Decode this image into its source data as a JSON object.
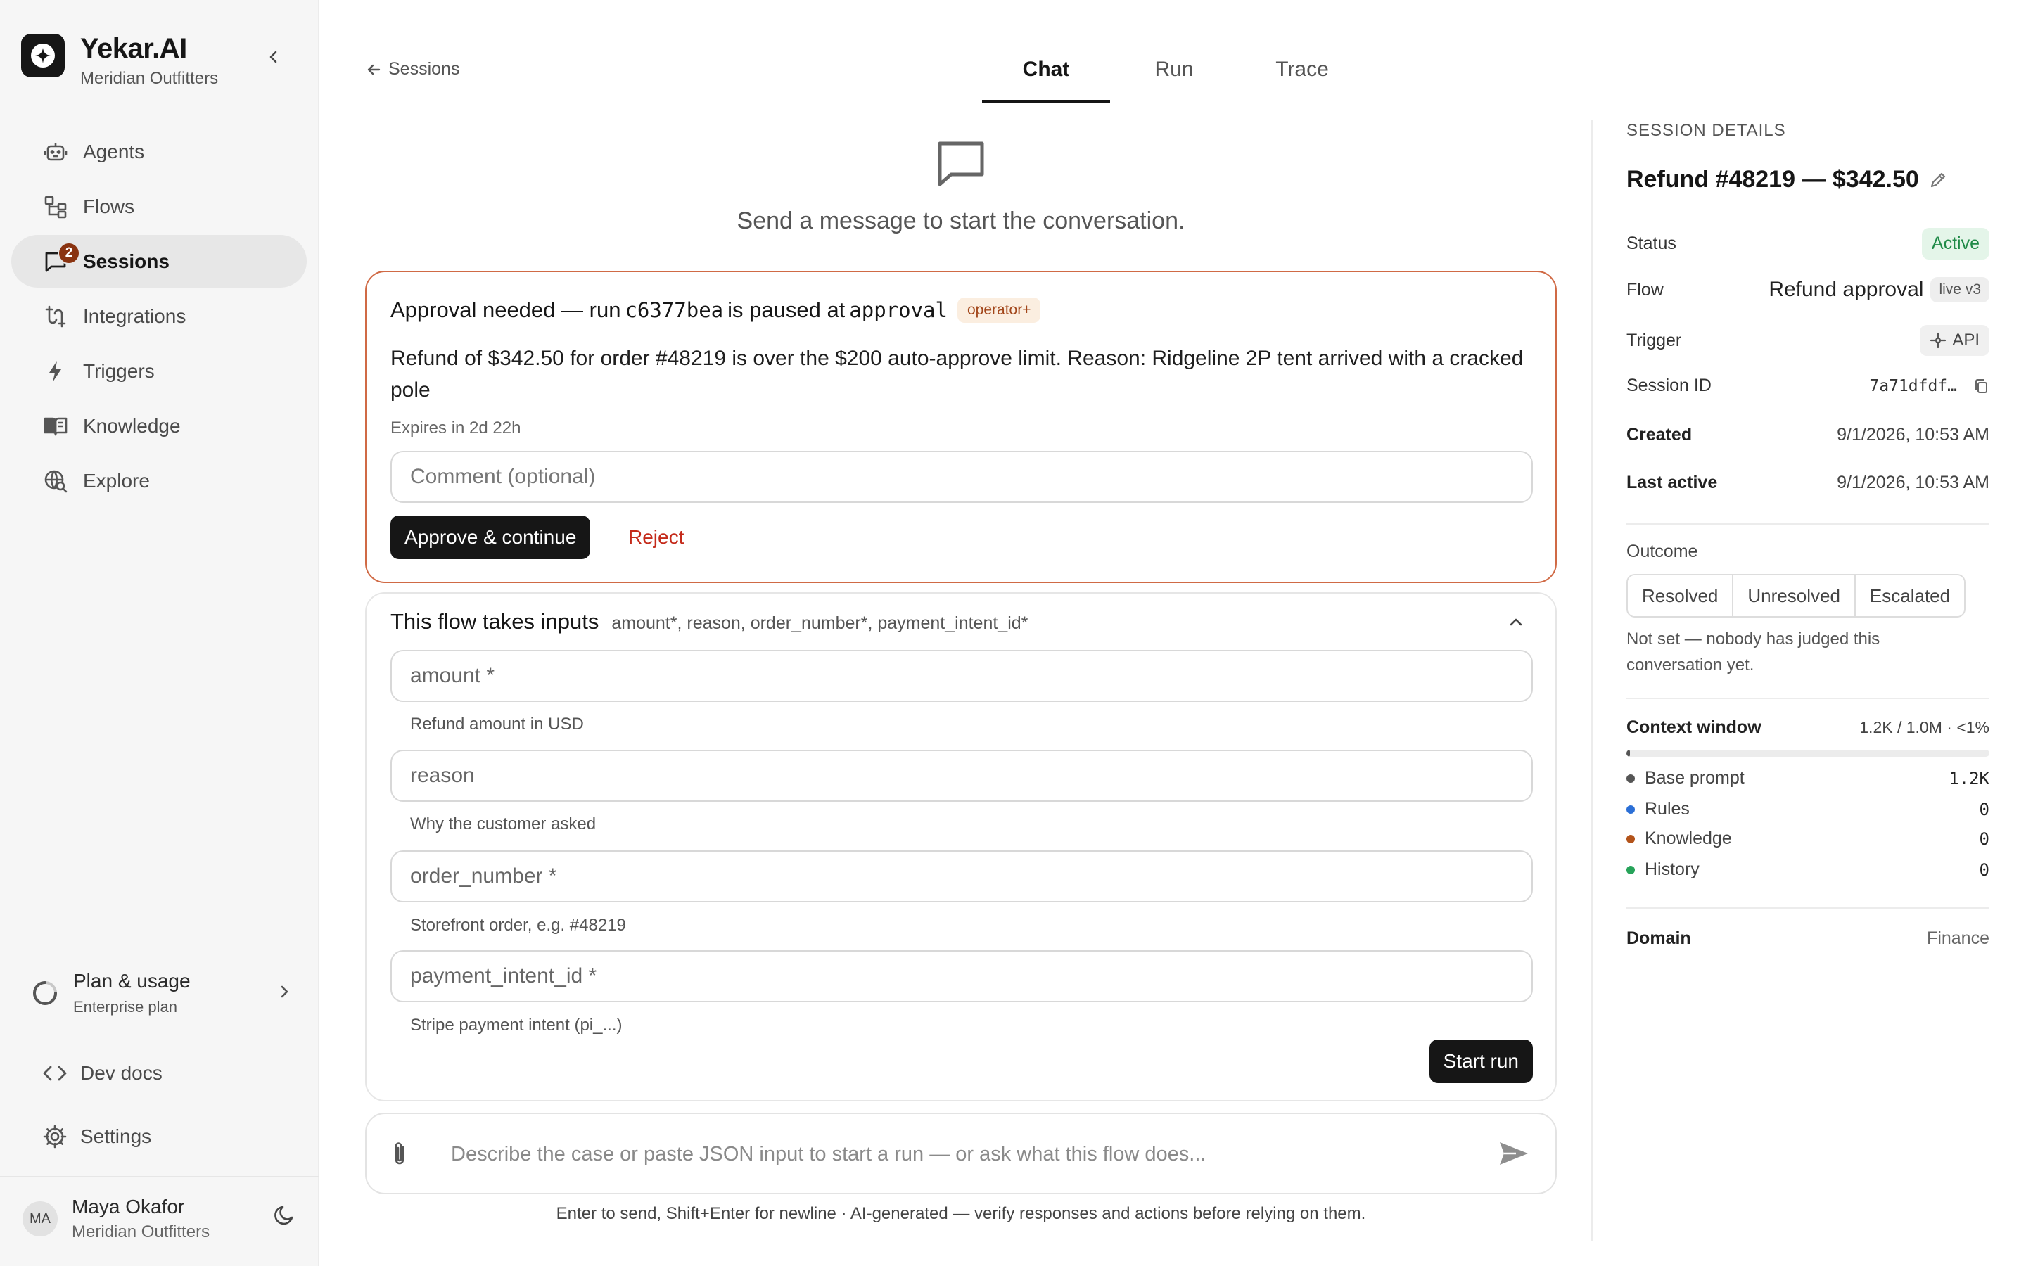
{
  "brand": {
    "name": "Yekar.AI",
    "org": "Meridian Outfitters"
  },
  "nav": {
    "items": [
      {
        "label": "Agents",
        "icon": "robot-icon"
      },
      {
        "label": "Flows",
        "icon": "flow-icon"
      },
      {
        "label": "Sessions",
        "icon": "chat-icon",
        "badge": "2",
        "active": true
      },
      {
        "label": "Integrations",
        "icon": "plug-icon"
      },
      {
        "label": "Triggers",
        "icon": "bolt-icon"
      },
      {
        "label": "Knowledge",
        "icon": "book-icon"
      },
      {
        "label": "Explore",
        "icon": "globe-search-icon"
      }
    ]
  },
  "plan": {
    "title": "Plan & usage",
    "sub": "Enterprise plan"
  },
  "devdocs": {
    "label": "Dev docs"
  },
  "settings": {
    "label": "Settings"
  },
  "user": {
    "initials": "MA",
    "name": "Maya Okafor",
    "org": "Meridian Outfitters"
  },
  "header": {
    "back_label": "Sessions",
    "tabs": [
      {
        "label": "Chat",
        "active": true
      },
      {
        "label": "Run"
      },
      {
        "label": "Trace"
      }
    ]
  },
  "empty_state": {
    "text": "Send a message to start the conversation."
  },
  "approval": {
    "title_prefix": "Approval needed — run",
    "run_id": "c6377bea",
    "title_mid": "is paused at",
    "step": "approval",
    "role_tag": "operator+",
    "reason": "Refund of $342.50 for order #48219 is over the $200 auto-approve limit. Reason: Ridgeline 2P tent arrived with a cracked pole",
    "expires": "Expires in 2d 22h",
    "comment_placeholder": "Comment (optional)",
    "approve_label": "Approve & continue",
    "reject_label": "Reject"
  },
  "inputs": {
    "title": "This flow takes inputs",
    "summary": "amount*, reason, order_number*, payment_intent_id*",
    "fields": [
      {
        "placeholder": "amount *",
        "hint": "Refund amount in USD"
      },
      {
        "placeholder": "reason",
        "hint": "Why the customer asked"
      },
      {
        "placeholder": "order_number *",
        "hint": "Storefront order, e.g. #48219"
      },
      {
        "placeholder": "payment_intent_id *",
        "hint": "Stripe payment intent (pi_...)"
      }
    ],
    "start_label": "Start run"
  },
  "composer": {
    "placeholder": "Describe the case or paste JSON input to start a run — or ask what this flow does...",
    "footer": "Enter to send, Shift+Enter for newline · AI-generated — verify responses and actions before relying on them."
  },
  "session": {
    "heading": "SESSION DETAILS",
    "title": "Refund #48219 — $342.50",
    "status_label": "Status",
    "status": "Active",
    "flow_label": "Flow",
    "flow": "Refund approval",
    "flow_version": "live v3",
    "trigger_label": "Trigger",
    "trigger": "API",
    "session_id_label": "Session ID",
    "session_id": "7a71dfdf…",
    "created_label": "Created",
    "created": "9/1/2026, 10:53 AM",
    "last_active_label": "Last active",
    "last_active": "9/1/2026, 10:53 AM",
    "outcome_label": "Outcome",
    "outcome_options": [
      "Resolved",
      "Unresolved",
      "Escalated"
    ],
    "outcome_note": "Not set — nobody has judged this conversation yet.",
    "context_label": "Context window",
    "context_usage": "1.2K / 1.0M · <1%",
    "context_fraction": 0.0012,
    "context_items": [
      {
        "label": "Base prompt",
        "value": "1.2K",
        "color": "#555555"
      },
      {
        "label": "Rules",
        "value": "0",
        "color": "#2b6fd6"
      },
      {
        "label": "Knowledge",
        "value": "0",
        "color": "#b3531a"
      },
      {
        "label": "History",
        "value": "0",
        "color": "#27a35a"
      }
    ],
    "domain_label": "Domain",
    "domain": "Finance"
  },
  "colors": {
    "accent": "#161616",
    "approval_border": "#d06a45",
    "reject": "#c42a1a",
    "active_badge": "#1f8a47",
    "nav_badge": "#8a3310"
  }
}
